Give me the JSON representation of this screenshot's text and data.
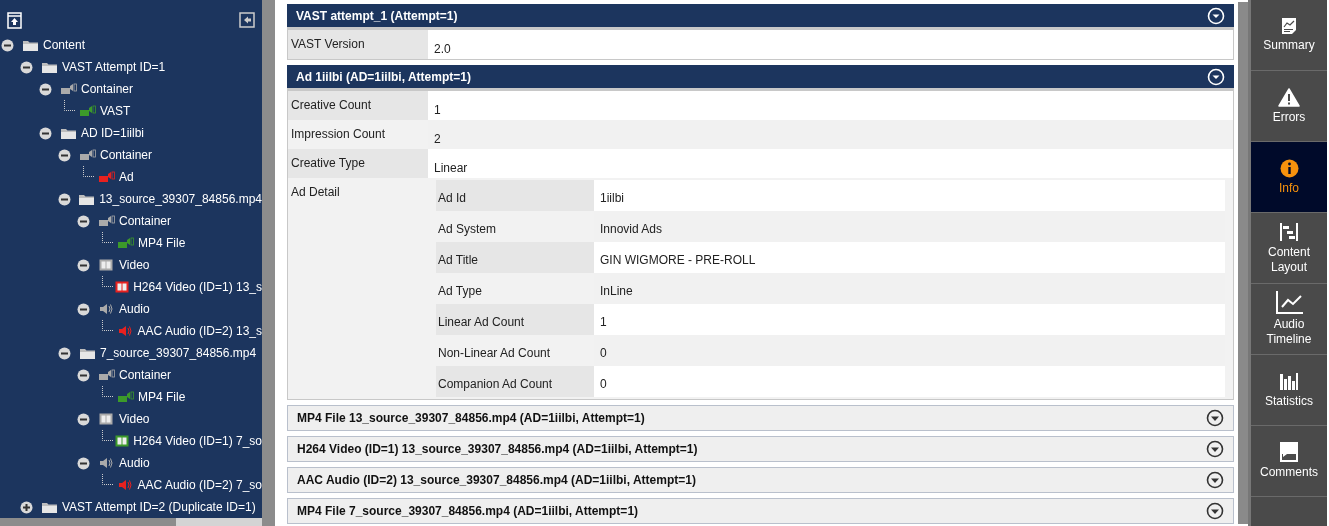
{
  "tree": [
    {
      "label": "Content",
      "kind": "folder",
      "expanded": true,
      "children": [
        {
          "label": "VAST Attempt ID=1",
          "kind": "folder",
          "expanded": true,
          "children": [
            {
              "label": "Container",
              "kind": "container",
              "expanded": true,
              "children": [
                {
                  "label": "VAST",
                  "kind": "file",
                  "color": "#3c9a2a"
                }
              ]
            },
            {
              "label": "AD ID=1iilbi",
              "kind": "folder",
              "expanded": true,
              "children": [
                {
                  "label": "Container",
                  "kind": "container",
                  "expanded": true,
                  "children": [
                    {
                      "label": "Ad",
                      "kind": "file",
                      "color": "#e8211f"
                    }
                  ]
                },
                {
                  "label": "13_source_39307_84856.mp4",
                  "kind": "folder",
                  "expanded": true,
                  "children": [
                    {
                      "label": "Container",
                      "kind": "container",
                      "expanded": true,
                      "children": [
                        {
                          "label": "MP4 File",
                          "kind": "file",
                          "color": "#3c9a2a"
                        }
                      ]
                    },
                    {
                      "label": "Video",
                      "kind": "video",
                      "expanded": true,
                      "children": [
                        {
                          "label": "H264 Video (ID=1) 13_s",
                          "kind": "video",
                          "color": "#e8211f"
                        }
                      ]
                    },
                    {
                      "label": "Audio",
                      "kind": "audio",
                      "expanded": true,
                      "children": [
                        {
                          "label": "AAC Audio (ID=2) 13_s",
                          "kind": "audio",
                          "color": "#e8211f"
                        }
                      ]
                    }
                  ]
                },
                {
                  "label": "7_source_39307_84856.mp4",
                  "kind": "folder",
                  "expanded": true,
                  "children": [
                    {
                      "label": "Container",
                      "kind": "container",
                      "expanded": true,
                      "children": [
                        {
                          "label": "MP4 File",
                          "kind": "file",
                          "color": "#3c9a2a"
                        }
                      ]
                    },
                    {
                      "label": "Video",
                      "kind": "video",
                      "expanded": true,
                      "children": [
                        {
                          "label": "H264 Video (ID=1) 7_so",
                          "kind": "video",
                          "color": "#3c9a2a"
                        }
                      ]
                    },
                    {
                      "label": "Audio",
                      "kind": "audio",
                      "expanded": true,
                      "children": [
                        {
                          "label": "AAC Audio (ID=2) 7_so",
                          "kind": "audio",
                          "color": "#e8211f"
                        }
                      ]
                    }
                  ]
                }
              ]
            }
          ]
        },
        {
          "label": "VAST Attempt ID=2 (Duplicate ID=1)",
          "kind": "folder",
          "expanded": false
        }
      ]
    }
  ],
  "sections": [
    {
      "title": "VAST attempt_1 (Attempt=1)",
      "expanded": true,
      "rows": [
        {
          "label": "VAST Version",
          "value": "2.0"
        }
      ]
    },
    {
      "title": "Ad 1iilbi (AD=1iilbi, Attempt=1)",
      "expanded": true,
      "rows": [
        {
          "label": "Creative Count",
          "value": "1"
        },
        {
          "label": "Impression Count",
          "value": "2"
        },
        {
          "label": "Creative Type",
          "value": "Linear"
        },
        {
          "label": "Ad Detail",
          "rows": [
            {
              "label": "Ad Id",
              "value": "1iilbi"
            },
            {
              "label": "Ad System",
              "value": "Innovid Ads"
            },
            {
              "label": "Ad Title",
              "value": "GIN WIGMORE - PRE-ROLL"
            },
            {
              "label": "Ad Type",
              "value": "InLine"
            },
            {
              "label": "Linear Ad Count",
              "value": "1"
            },
            {
              "label": "Non-Linear Ad Count",
              "value": "0"
            },
            {
              "label": "Companion Ad Count",
              "value": "0"
            }
          ]
        }
      ]
    },
    {
      "title": "MP4 File 13_source_39307_84856.mp4 (AD=1iilbi, Attempt=1)",
      "expanded": false
    },
    {
      "title": "H264 Video (ID=1) 13_source_39307_84856.mp4 (AD=1iilbi, Attempt=1)",
      "expanded": false
    },
    {
      "title": "AAC Audio (ID=2) 13_source_39307_84856.mp4 (AD=1iilbi, Attempt=1)",
      "expanded": false
    },
    {
      "title": "MP4 File 7_source_39307_84856.mp4 (AD=1iilbi, Attempt=1)",
      "expanded": false
    }
  ],
  "nav": [
    {
      "label": "Summary",
      "kind": "report",
      "selected": false
    },
    {
      "label": "Errors",
      "kind": "warning",
      "selected": false
    },
    {
      "label": "Info",
      "kind": "info",
      "selected": true
    },
    {
      "label": "Content Layout",
      "kind": "layout",
      "selected": false
    },
    {
      "label": "Audio Timeline",
      "kind": "chart",
      "selected": false
    },
    {
      "label": "Statistics",
      "kind": "stats",
      "selected": false
    },
    {
      "label": "Comments",
      "kind": "comment",
      "selected": false
    }
  ]
}
